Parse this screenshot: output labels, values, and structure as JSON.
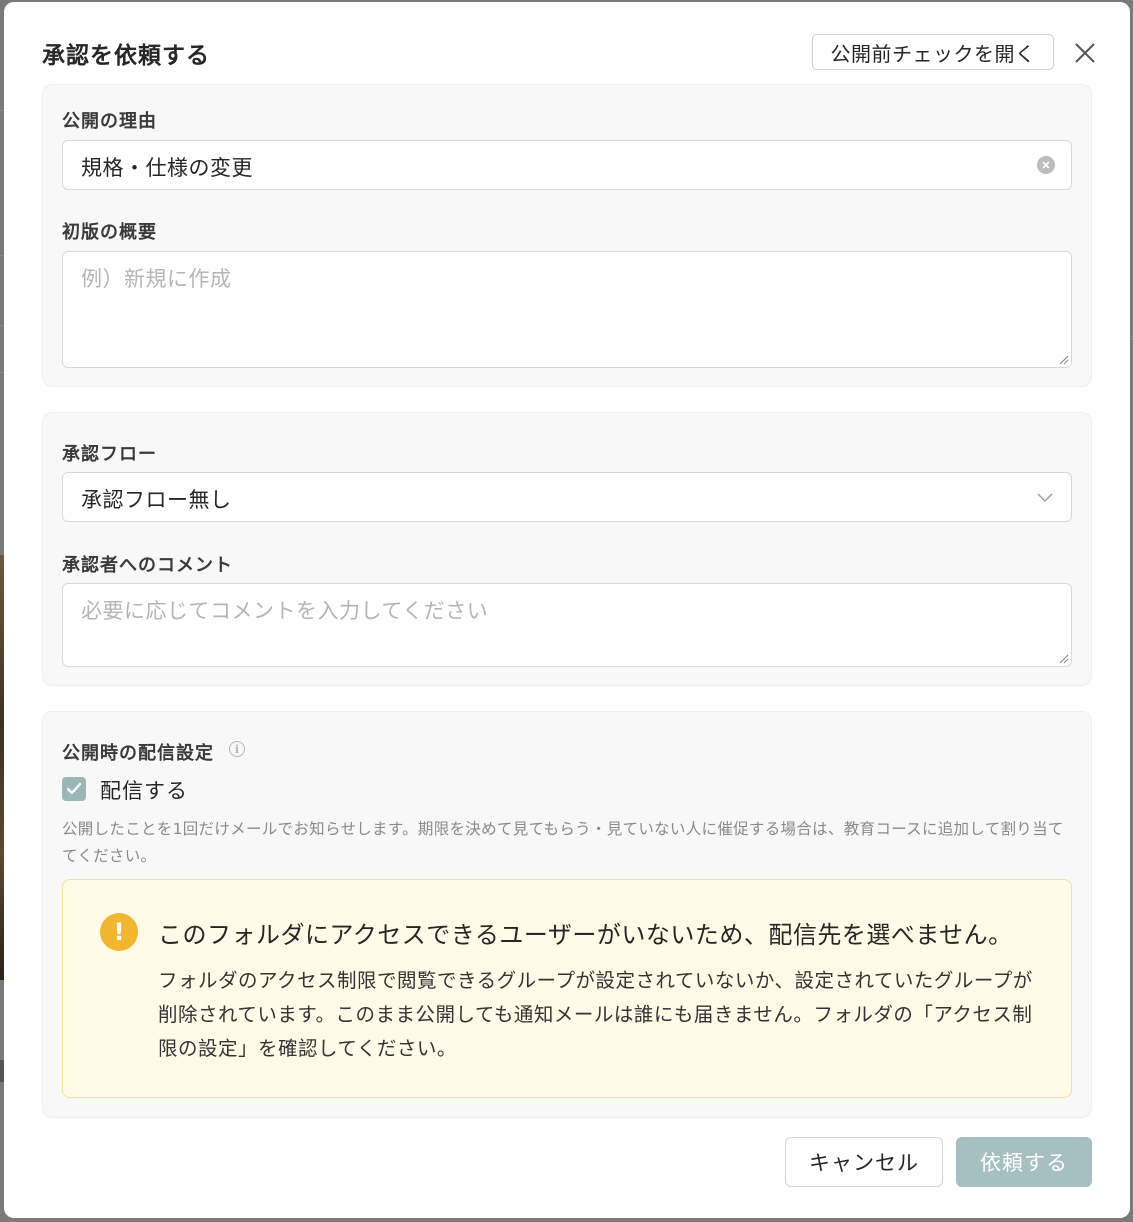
{
  "modal": {
    "title": "承認を依頼する",
    "precheck_button": "公開前チェックを開く"
  },
  "reason": {
    "label": "公開の理由",
    "value": "規格・仕様の変更"
  },
  "summary": {
    "label": "初版の概要",
    "placeholder": "例）新規に作成"
  },
  "flow": {
    "label": "承認フロー",
    "selected": "承認フロー無し"
  },
  "comment": {
    "label": "承認者へのコメント",
    "placeholder": "必要に応じてコメントを入力してください"
  },
  "delivery": {
    "label": "公開時の配信設定",
    "checkbox_label": "配信する",
    "checked": true,
    "help_text": "公開したことを1回だけメールでお知らせします。期限を決めて見てもらう・見ていない人に催促する場合は、教育コースに追加して割り当ててください。"
  },
  "warning": {
    "title": "このフォルダにアクセスできるユーザーがいないため、配信先を選べません。",
    "body": "フォルダのアクセス制限で閲覧できるグループが設定されていないか、設定されていたグループが削除されています。このまま公開しても通知メールは誰にも届きません。フォルダの「アクセス制限の設定」を確認してください。"
  },
  "footer": {
    "cancel_label": "キャンセル",
    "submit_label": "依頼する"
  },
  "colors": {
    "primary_disabled": "#a6bfc1",
    "checkbox": "#9bb6b9",
    "warning_bg": "#fffbe6",
    "warning_icon": "#f4b62f"
  }
}
